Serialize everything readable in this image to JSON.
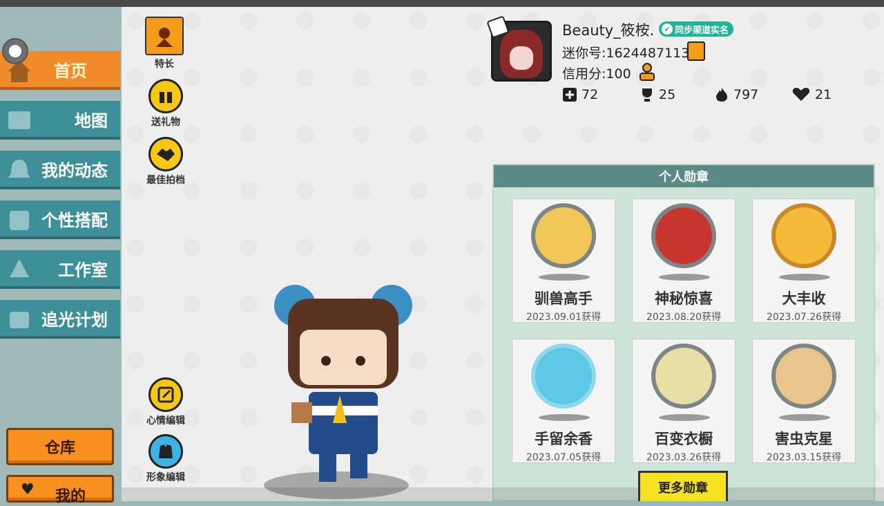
{
  "sidebar": {
    "items": [
      {
        "label": "首页",
        "icon": "home-icon",
        "active": true
      },
      {
        "label": "地图",
        "icon": "map-icon",
        "active": false
      },
      {
        "label": "我的动态",
        "icon": "bell-icon",
        "active": false
      },
      {
        "label": "个性搭配",
        "icon": "outfit-icon",
        "active": false
      },
      {
        "label": "工作室",
        "icon": "tree-icon",
        "active": false
      },
      {
        "label": "追光计划",
        "icon": "spotlight-icon",
        "active": false
      }
    ],
    "warehouse_label": "仓库",
    "mine_label": "我的"
  },
  "actions": {
    "specialty": "特长",
    "send_gift": "送礼物",
    "best_partner": "最佳拍档",
    "mood_edit": "心情编辑",
    "image_edit": "形象编辑"
  },
  "profile": {
    "username": "Beauty_筱桉.",
    "verify_badge": "同步渠道实名",
    "mini_id": "迷你号:1624487113",
    "credit": "信用分:100",
    "stats": [
      {
        "icon": "plus-icon",
        "value": "72"
      },
      {
        "icon": "trophy-icon",
        "value": "25"
      },
      {
        "icon": "flame-icon",
        "value": "797"
      },
      {
        "icon": "heart-icon",
        "value": "21"
      }
    ]
  },
  "medals": {
    "title": "个人勋章",
    "more_button": "更多勋章",
    "items": [
      {
        "name": "驯兽高手",
        "date": "2023.09.01获得",
        "color": "#f2c75a"
      },
      {
        "name": "神秘惊喜",
        "date": "2023.08.20获得",
        "color": "#c8352f"
      },
      {
        "name": "大丰收",
        "date": "2023.07.26获得",
        "color": "#f5b938"
      },
      {
        "name": "手留余香",
        "date": "2023.07.05获得",
        "color": "#5cc8e6"
      },
      {
        "name": "百变衣橱",
        "date": "2023.03.26获得",
        "color": "#e7dfa6"
      },
      {
        "name": "害虫克星",
        "date": "2023.03.15获得",
        "color": "#e9c58d"
      }
    ]
  },
  "colors": {
    "nav_bg": "#3d8f98",
    "nav_active": "#f08a2a",
    "panel_header": "#5a8a86",
    "panel_bg": "#cfe4d9"
  }
}
